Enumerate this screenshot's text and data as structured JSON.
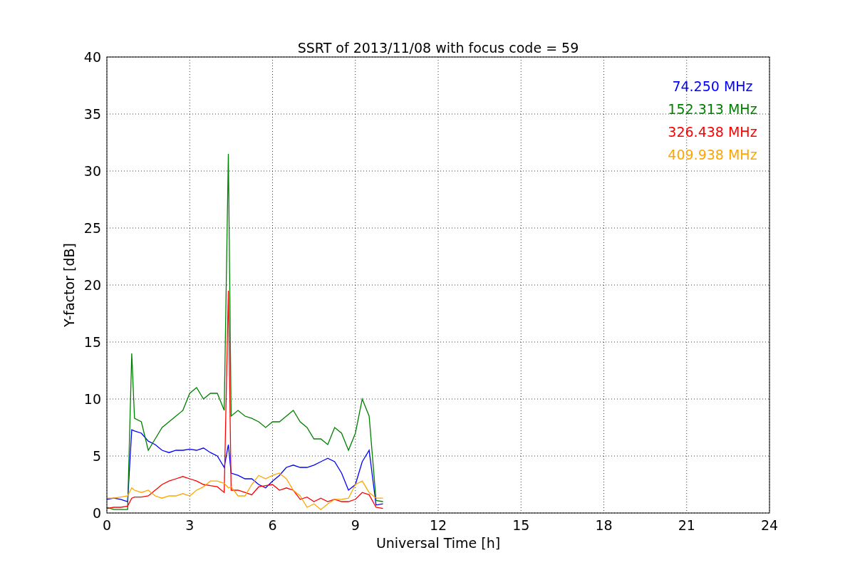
{
  "chart_data": {
    "type": "line",
    "title": "SSRT of 2013/11/08 with focus code = 59",
    "xlabel": "Universal Time [h]",
    "ylabel": "Y-factor [dB]",
    "x": [
      0,
      0.25,
      0.5,
      0.75,
      0.9,
      1,
      1.25,
      1.5,
      1.75,
      2,
      2.25,
      2.5,
      2.75,
      3,
      3.25,
      3.5,
      3.75,
      4,
      4.25,
      4.4,
      4.5,
      4.75,
      5,
      5.25,
      5.5,
      5.75,
      6,
      6.25,
      6.5,
      6.75,
      7,
      7.25,
      7.5,
      7.75,
      8,
      8.25,
      8.5,
      8.75,
      9,
      9.25,
      9.5,
      9.75,
      10
    ],
    "series": [
      {
        "name": "74.250 MHz",
        "color": "#0000ff",
        "values": [
          1.2,
          1.3,
          1.2,
          1.0,
          7.3,
          7.2,
          7.0,
          6.3,
          6.0,
          5.5,
          5.3,
          5.5,
          5.5,
          5.6,
          5.5,
          5.7,
          5.3,
          5.0,
          4.0,
          6.0,
          3.5,
          3.3,
          3.0,
          3.0,
          2.5,
          2.2,
          2.8,
          3.3,
          4.0,
          4.2,
          4.0,
          4.0,
          4.2,
          4.5,
          4.8,
          4.5,
          3.5,
          2.0,
          2.5,
          4.5,
          5.5,
          0.7,
          0.8
        ]
      },
      {
        "name": "152.313 MHz",
        "color": "#008000",
        "values": [
          0.5,
          0.3,
          0.3,
          0.3,
          14.0,
          8.3,
          8.0,
          5.5,
          6.5,
          7.5,
          8.0,
          8.5,
          9.0,
          10.5,
          11.0,
          10.0,
          10.5,
          10.5,
          9.0,
          31.5,
          8.5,
          9.0,
          8.5,
          8.3,
          8.0,
          7.5,
          8.0,
          8.0,
          8.5,
          9.0,
          8.0,
          7.5,
          6.5,
          6.5,
          6.0,
          7.5,
          7.0,
          5.5,
          7.0,
          10.0,
          8.5,
          1.1,
          1.0
        ]
      },
      {
        "name": "326.438 MHz",
        "color": "#ff0000",
        "values": [
          0.4,
          0.5,
          0.5,
          0.6,
          1.3,
          1.4,
          1.4,
          1.5,
          2.0,
          2.5,
          2.8,
          3.0,
          3.2,
          3.0,
          2.8,
          2.5,
          2.4,
          2.3,
          1.8,
          19.5,
          2.0,
          2.0,
          1.8,
          1.6,
          2.3,
          2.4,
          2.5,
          2.0,
          2.2,
          2.0,
          1.2,
          1.4,
          1.0,
          1.3,
          1.0,
          1.2,
          1.0,
          1.0,
          1.2,
          1.8,
          1.6,
          0.5,
          0.4
        ]
      },
      {
        "name": "409.938 MHz",
        "color": "#ffa500",
        "values": [
          1.3,
          1.3,
          1.4,
          1.5,
          2.2,
          2.0,
          1.8,
          2.0,
          1.5,
          1.3,
          1.5,
          1.5,
          1.7,
          1.5,
          2.0,
          2.3,
          2.8,
          2.8,
          2.6,
          2.2,
          2.3,
          1.5,
          1.5,
          2.5,
          3.3,
          3.0,
          3.3,
          3.5,
          3.0,
          2.0,
          1.5,
          0.5,
          0.8,
          0.3,
          0.8,
          1.2,
          1.2,
          1.3,
          2.5,
          2.8,
          1.8,
          1.3,
          1.3
        ]
      }
    ],
    "grid": true,
    "xlim": [
      0,
      24
    ],
    "ylim": [
      0,
      40
    ],
    "xticks": [
      0,
      3,
      6,
      9,
      12,
      15,
      18,
      21,
      24
    ],
    "yticks": [
      0,
      5,
      10,
      15,
      20,
      25,
      30,
      35,
      40
    ]
  }
}
